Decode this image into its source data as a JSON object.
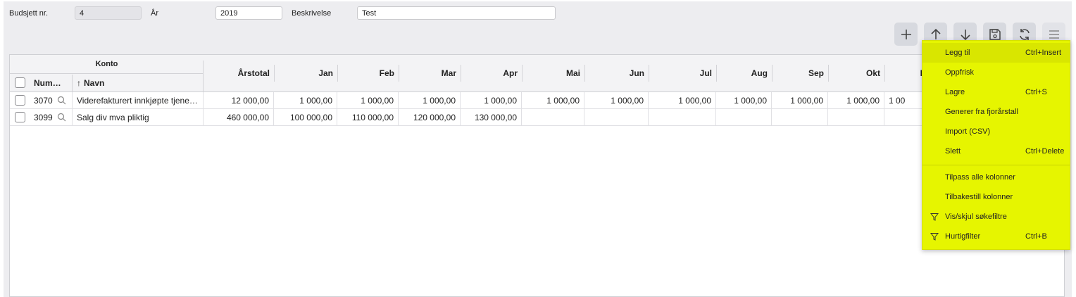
{
  "form": {
    "budget_no_label": "Budsjett nr.",
    "budget_no_value": "4",
    "year_label": "År",
    "year_value": "2019",
    "description_label": "Beskrivelse",
    "description_value": "Test"
  },
  "toolbar": {
    "add_icon": "plus-icon",
    "up_icon": "arrow-up-icon",
    "down_icon": "arrow-down-icon",
    "save_icon": "save-icon",
    "refresh_icon": "refresh-icon",
    "menu_icon": "hamburger-icon"
  },
  "grid": {
    "group_header": "Konto",
    "number_header": "Num…",
    "name_header": "Navn",
    "sort_indicator": "↑",
    "month_columns": [
      "Årstotal",
      "Jan",
      "Feb",
      "Mar",
      "Apr",
      "Mai",
      "Jun",
      "Jul",
      "Aug",
      "Sep",
      "Okt"
    ],
    "rows": [
      {
        "number": "3070",
        "name": "Viderefakturert innkjøpte tjene…",
        "values": [
          "12 000,00",
          "1 000,00",
          "1 000,00",
          "1 000,00",
          "1 000,00",
          "1 000,00",
          "1 000,00",
          "1 000,00",
          "1 000,00",
          "1 000,00",
          "1 000,00"
        ],
        "partial_next": "1 00"
      },
      {
        "number": "3099",
        "name": "Salg div mva pliktig",
        "values": [
          "460 000,00",
          "100 000,00",
          "110 000,00",
          "120 000,00",
          "130 000,00",
          "",
          "",
          "",
          "",
          "",
          ""
        ],
        "partial_next": ""
      }
    ],
    "partial_header": "I"
  },
  "context_menu": {
    "items": [
      {
        "label": "Legg til",
        "shortcut": "Ctrl+Insert"
      },
      {
        "label": "Oppfrisk",
        "shortcut": ""
      },
      {
        "label": "Lagre",
        "shortcut": "Ctrl+S"
      },
      {
        "label": "Generer fra fjorårstall",
        "shortcut": ""
      },
      {
        "label": "Import (CSV)",
        "shortcut": ""
      },
      {
        "label": "Slett",
        "shortcut": "Ctrl+Delete"
      },
      {
        "label": "Tilpass alle kolonner",
        "shortcut": ""
      },
      {
        "label": "Tilbakestill kolonner",
        "shortcut": ""
      },
      {
        "label": "Vis/skjul søkefiltre",
        "shortcut": ""
      },
      {
        "label": "Hurtigfilter",
        "shortcut": "Ctrl+B"
      }
    ],
    "highlight_color": "#e6f500"
  }
}
